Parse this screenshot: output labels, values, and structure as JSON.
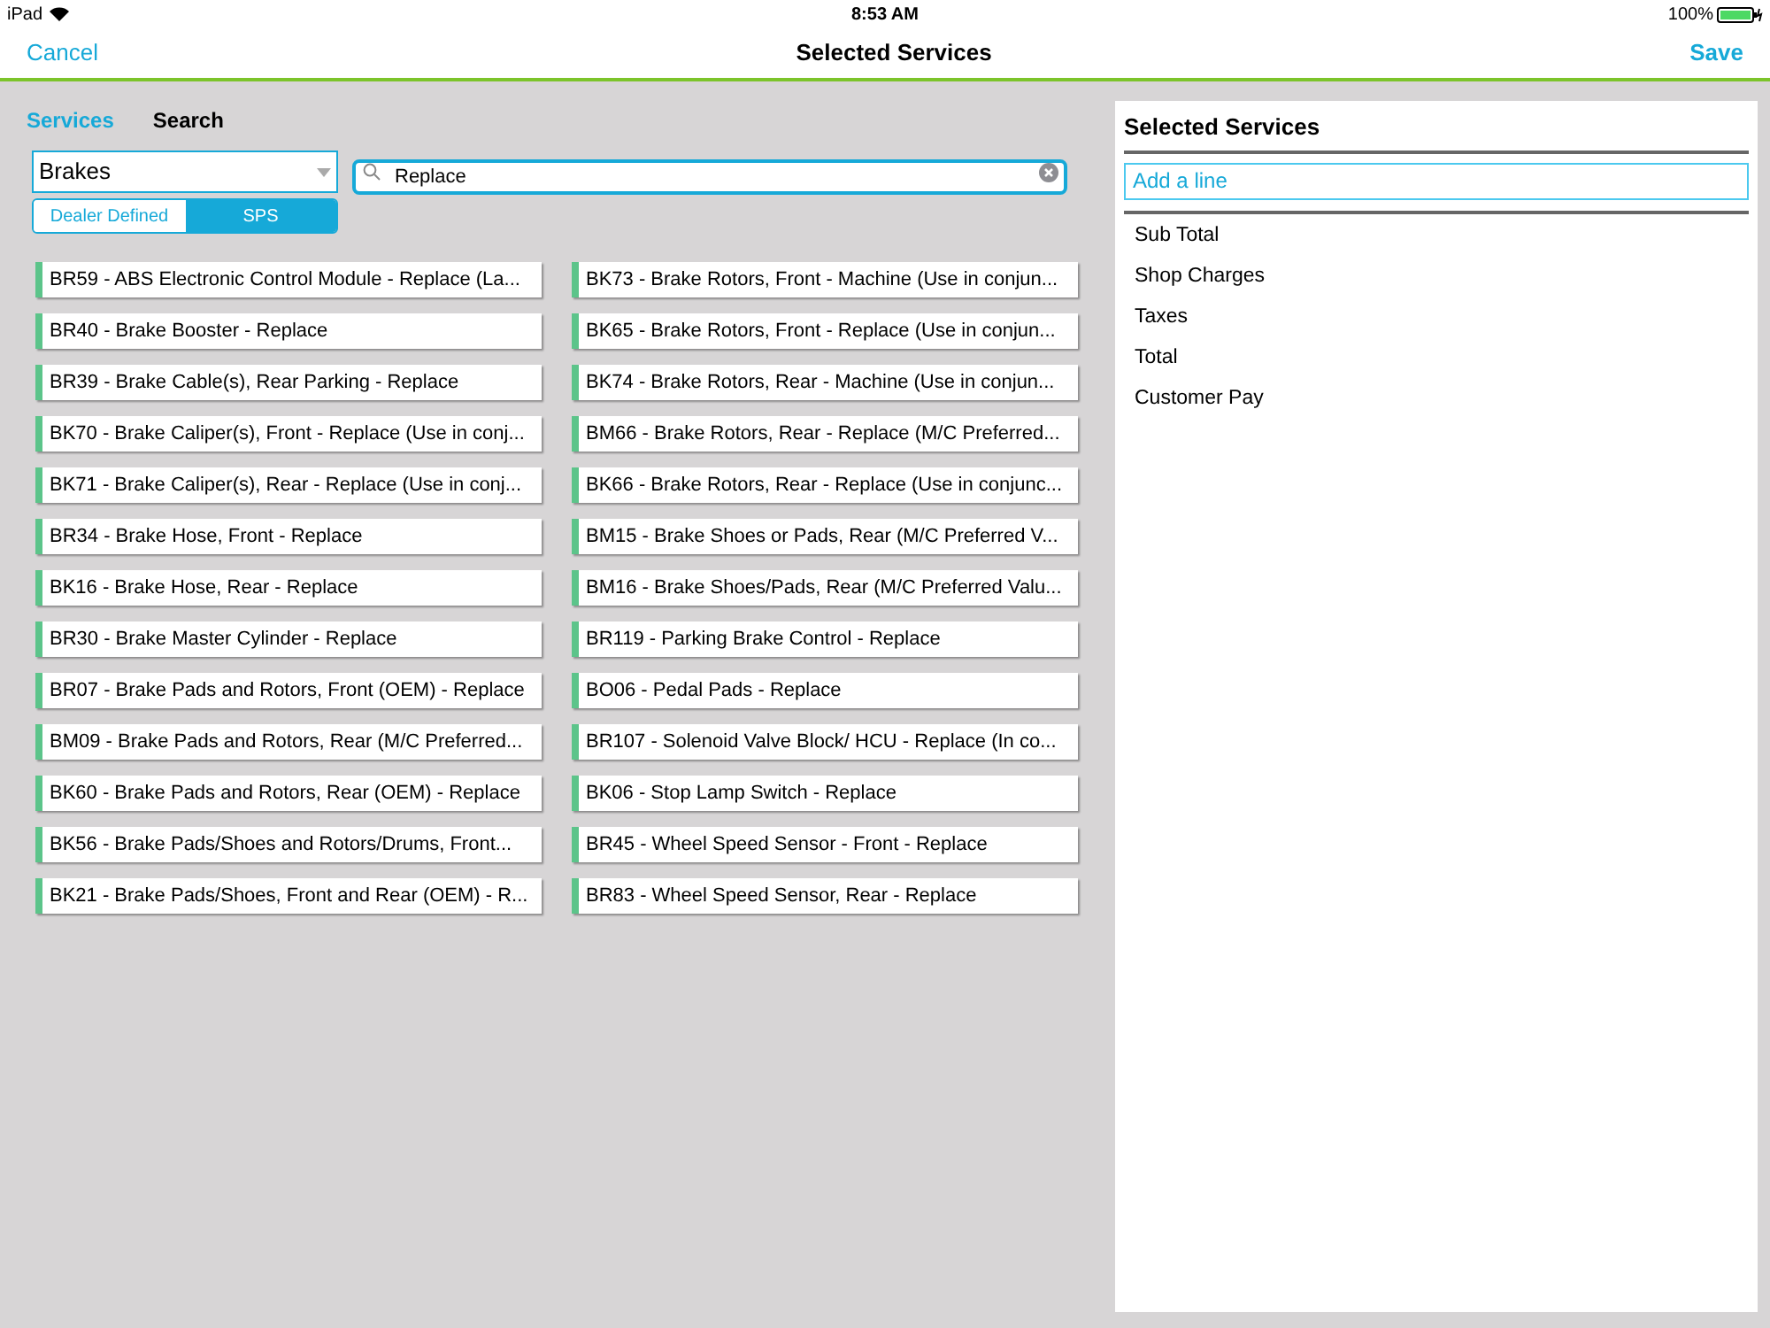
{
  "status_bar": {
    "device": "iPad",
    "time": "8:53 AM",
    "battery": "100%"
  },
  "nav_bar": {
    "left_button": "Cancel",
    "title": "Selected Services",
    "right_button": "Save"
  },
  "tabs": [
    {
      "label": "Services",
      "selected": true
    },
    {
      "label": "Search",
      "selected": false
    }
  ],
  "category_dropdown": {
    "value": "Brakes"
  },
  "segments": [
    {
      "label": "Dealer Defined",
      "selected": false
    },
    {
      "label": "SPS",
      "selected": true
    }
  ],
  "search": {
    "value": "Replace"
  },
  "services": [
    "BR59 - ABS Electronic Control Module - Replace (La...",
    "BK73 - Brake Rotors, Front - Machine (Use in conjun...",
    "BR40 - Brake Booster - Replace",
    "BK65 - Brake Rotors, Front - Replace (Use in conjun...",
    "BR39 - Brake Cable(s), Rear Parking - Replace",
    "BK74 - Brake Rotors, Rear - Machine (Use in conjun...",
    "BK70 - Brake Caliper(s), Front - Replace (Use in conj...",
    "BM66 - Brake Rotors, Rear - Replace (M/C Preferred...",
    "BK71 - Brake Caliper(s), Rear - Replace (Use in conj...",
    "BK66 - Brake Rotors, Rear - Replace (Use in conjunc...",
    "BR34 - Brake Hose, Front - Replace",
    "BM15 - Brake Shoes or Pads, Rear (M/C Preferred V...",
    "BK16 - Brake Hose, Rear - Replace",
    "BM16 - Brake Shoes/Pads, Rear (M/C Preferred Valu...",
    "BR30 - Brake Master Cylinder - Replace",
    "BR119 - Parking Brake Control - Replace",
    "BR07 - Brake Pads and Rotors, Front (OEM) - Replace",
    "BO06 - Pedal Pads - Replace",
    "BM09 - Brake Pads and Rotors, Rear (M/C Preferred...",
    "BR107 - Solenoid Valve Block/ HCU - Replace (In co...",
    "BK60 - Brake Pads and Rotors, Rear (OEM) - Replace",
    "BK06 - Stop Lamp Switch - Replace",
    "BK56 - Brake Pads/Shoes and Rotors/Drums, Front...",
    "BR45 - Wheel Speed Sensor - Front - Replace",
    "BK21 - Brake Pads/Shoes, Front and Rear (OEM) - R...",
    "BR83 - Wheel Speed Sensor, Rear - Replace"
  ],
  "selected_panel": {
    "title": "Selected Services",
    "add_line": {
      "placeholder": "Add a line"
    },
    "summary": [
      "Sub Total",
      "Shop Charges",
      "Taxes",
      "Total",
      "Customer Pay"
    ]
  }
}
